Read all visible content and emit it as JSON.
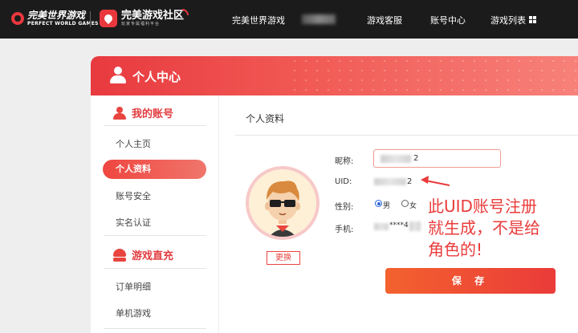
{
  "header": {
    "logo_brand_cn": "完美世界游戏",
    "logo_brand_en": "PERFECT WORLD GAMES",
    "logo_community_cn": "完美游戏社区",
    "logo_community_sub": "玩家专属福利平台",
    "nav": [
      "完美世界游戏",
      "游戏客服",
      "账号中心",
      "游戏列表"
    ]
  },
  "banner": {
    "title": "个人中心"
  },
  "sidebar": {
    "section_account": "我的账号",
    "account_items": [
      "个人主页",
      "个人资料",
      "账号安全",
      "实名认证"
    ],
    "active_item": "个人资料",
    "section_games": "游戏直充",
    "game_items": [
      "订单明细",
      "单机游戏"
    ]
  },
  "profile": {
    "title": "个人资料",
    "change_avatar": "更换",
    "nickname_label": "昵称:",
    "nickname_value_suffix": "2",
    "uid_label": "UID:",
    "uid_value_suffix": "2",
    "gender_label": "性别:",
    "gender_options": [
      "男",
      "女"
    ],
    "gender_selected": "男",
    "phone_label": "手机:",
    "phone_value_visible": "****4",
    "save_label": "保 存"
  },
  "annotation": {
    "text_lines": [
      "此UID账号注册",
      "就生成，不是给",
      "角色的!"
    ],
    "color": "#ea3b3b"
  },
  "colors": {
    "accent": "#e8453f",
    "topbar": "#1b1b1b",
    "page_bg": "#eeeeee"
  }
}
